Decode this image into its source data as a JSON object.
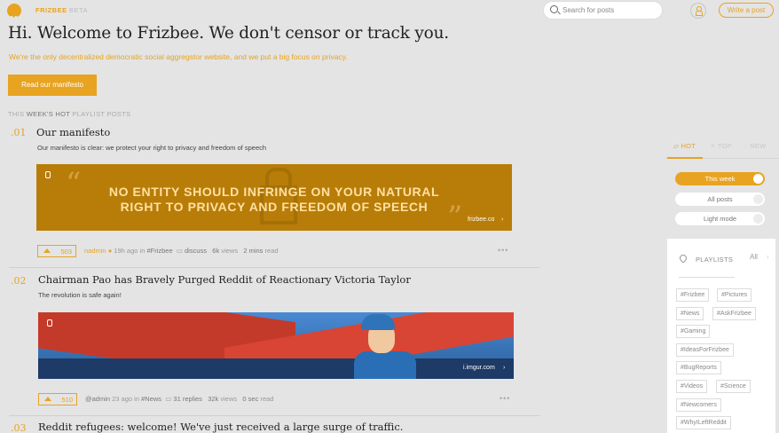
{
  "header": {
    "brand": "FRIZBEE",
    "beta": "BETA",
    "search_placeholder": "Search for posts",
    "write_label": "Write a post"
  },
  "hero": {
    "title": "Hi. Welcome to Frizbee. We don't censor or track you.",
    "subtitle": "We're the only decentralized democratic social aggregstor website, and we put a big focus on privacy.",
    "manifesto_label": "Read our manifesto"
  },
  "section": {
    "pre": "THIS",
    "bold": "WEEK'S HOT",
    "post": "PLAYLIST POSTS"
  },
  "posts": [
    {
      "num": ".01",
      "title": "Our manifesto",
      "desc": "Our manifesto is clear: we protect your right to privacy and freedom of speech",
      "banner_line1": "NO ENTITY SHOULD INFRINGE ON YOUR NATURAL",
      "banner_line2": "RIGHT TO PRIVACY AND FREEDOM OF SPEECH",
      "banner_site": "frizbee.co",
      "votes": "503",
      "user": "nadmin",
      "ago": "19h ago in",
      "tag": "#Frizbee",
      "comments": "discuss",
      "views": "6k",
      "views_label": "views",
      "read": "2 mins",
      "read_label": "read"
    },
    {
      "num": ".02",
      "title": "Chairman Pao has Bravely Purged Reddit of Reactionary Victoria Taylor",
      "desc": "The revolution is safe again!",
      "banner_site": "i.imgur.com",
      "votes": "510",
      "user": "@admin",
      "ago": "23 ago in",
      "tag": "#News",
      "comments": "31 replies",
      "views": "32k",
      "views_label": "views",
      "read": "0 sec",
      "read_label": "read"
    },
    {
      "num": ".03",
      "title": "Reddit refugees: welcome! We've just received a large surge of traffic."
    }
  ],
  "sidebar": {
    "tabs": [
      "HOT",
      "TOP",
      "NEW"
    ],
    "toggles": [
      "This week",
      "All posts",
      "Light mode"
    ],
    "playlists_label": "PLAYLISTS",
    "all_label": "All",
    "tags": [
      "#Frizbee",
      "#Pictures",
      "#News",
      "#AskFrizbee",
      "#Gaming",
      "#IdeasForFrizbee",
      "#BugReports",
      "#Videos",
      "#Science",
      "#Newcomers",
      "#WhyILeftReddit"
    ]
  },
  "colors": {
    "accent": "#e8a321",
    "background": "#e4e4e4"
  }
}
